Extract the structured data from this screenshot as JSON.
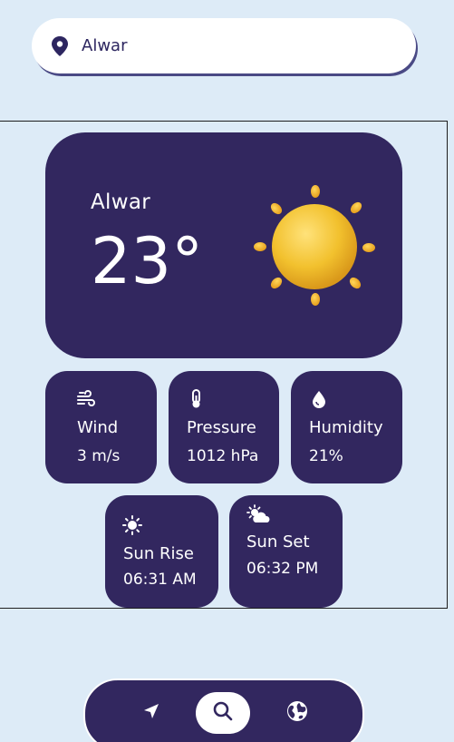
{
  "search": {
    "value": "Alwar",
    "icon": "location-pin-icon"
  },
  "weather": {
    "city": "Alwar",
    "temperature": "23°",
    "condition_icon": "sun-icon"
  },
  "details": [
    {
      "label": "Wind",
      "value": "3 m/s",
      "icon": "wind-icon"
    },
    {
      "label": "Pressure",
      "value": "1012 hPa",
      "icon": "thermometer-icon"
    },
    {
      "label": "Humidity",
      "value": "21%",
      "icon": "water-drop-icon"
    },
    {
      "label": "Sun Rise",
      "value": "06:31 AM",
      "icon": "sun-small-icon"
    },
    {
      "label": "Sun Set",
      "value": "06:32 PM",
      "icon": "sun-cloud-icon"
    }
  ],
  "nav": {
    "items": [
      {
        "name": "location",
        "icon": "navigation-arrow-icon",
        "active": false
      },
      {
        "name": "search",
        "icon": "search-icon",
        "active": true
      },
      {
        "name": "globe",
        "icon": "globe-icon",
        "active": false
      }
    ]
  },
  "colors": {
    "background": "#ddebf7",
    "card": "#32275f",
    "text_on_card": "#ffffff",
    "accent_sun": "#f2c12e"
  }
}
